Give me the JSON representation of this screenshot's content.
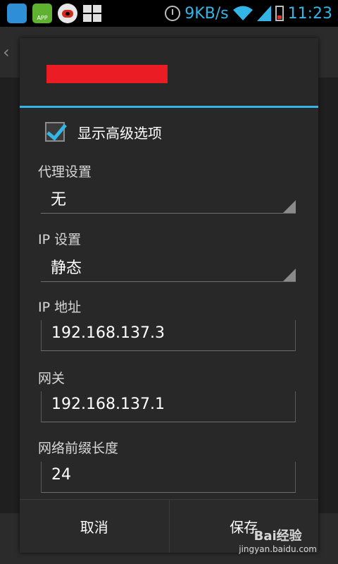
{
  "status_bar": {
    "app1_icon": "app-icon",
    "app2_label": "APP",
    "speed": "9KB/s",
    "time": "11:23",
    "accent": "#33b5e5"
  },
  "dialog": {
    "title_redacted": "",
    "show_advanced_label": "显示高级选项",
    "show_advanced_checked": true,
    "proxy_label": "代理设置",
    "proxy_value": "无",
    "ip_settings_label": "IP 设置",
    "ip_settings_value": "静态",
    "ip_address_label": "IP 地址",
    "ip_address_value": "192.168.137.3",
    "gateway_label": "网关",
    "gateway_value": "192.168.137.1",
    "prefix_label": "网络前缀长度",
    "prefix_value": "24",
    "cancel_label": "取消",
    "save_label": "保存"
  },
  "watermark": {
    "brand": "Bai经验",
    "url": "jingyan.baidu.com"
  }
}
